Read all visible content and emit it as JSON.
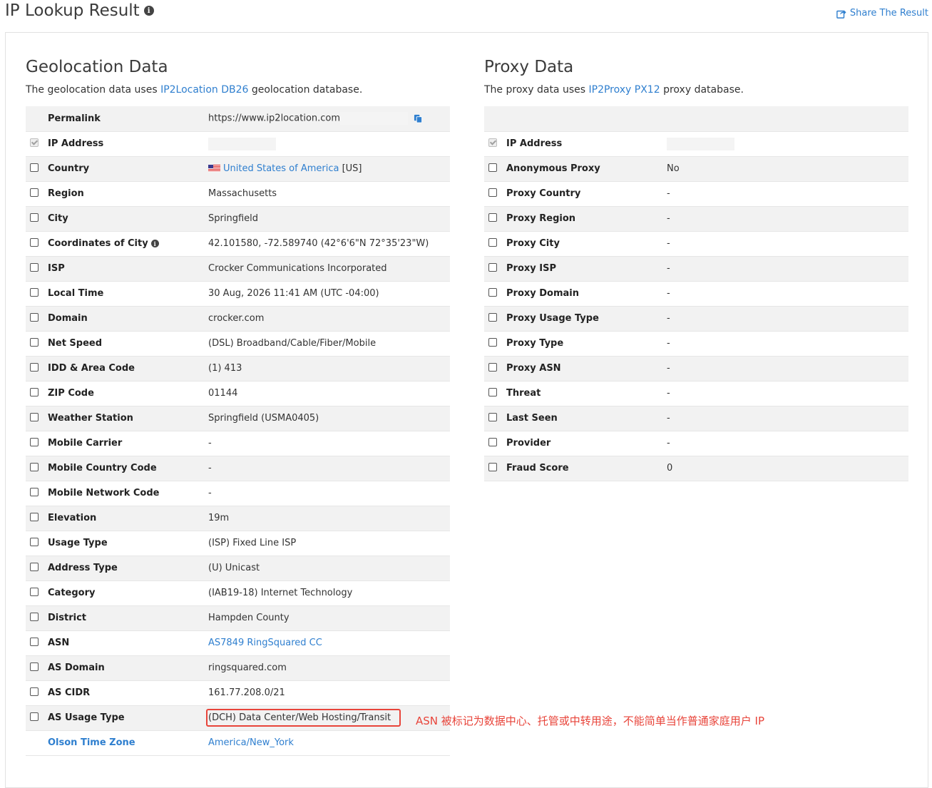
{
  "header": {
    "title": "IP Lookup Result",
    "share_label": "Share The Result"
  },
  "geo": {
    "title": "Geolocation Data",
    "desc_before": "The geolocation data uses ",
    "desc_link": "IP2Location DB26",
    "desc_after": " geolocation database.",
    "permalink_label": "Permalink",
    "permalink_value": "https://www.ip2location.com",
    "rows": [
      {
        "label": "IP Address",
        "value": ""
      },
      {
        "label": "Country",
        "value": "United States of America",
        "suffix": " [US]"
      },
      {
        "label": "Region",
        "value": "Massachusetts"
      },
      {
        "label": "City",
        "value": "Springfield"
      },
      {
        "label": "Coordinates of City",
        "value": "42.101580, -72.589740 (42°6'6\"N   72°35'23\"W)"
      },
      {
        "label": "ISP",
        "value": "Crocker Communications Incorporated"
      },
      {
        "label": "Local Time",
        "value": "30 Aug, 2026 11:41 AM (UTC -04:00)"
      },
      {
        "label": "Domain",
        "value": "crocker.com"
      },
      {
        "label": "Net Speed",
        "value": "(DSL) Broadband/Cable/Fiber/Mobile"
      },
      {
        "label": "IDD & Area Code",
        "value": "(1) 413"
      },
      {
        "label": "ZIP Code",
        "value": "01144"
      },
      {
        "label": "Weather Station",
        "value": "Springfield (USMA0405)"
      },
      {
        "label": "Mobile Carrier",
        "value": "-"
      },
      {
        "label": "Mobile Country Code",
        "value": "-"
      },
      {
        "label": "Mobile Network Code",
        "value": "-"
      },
      {
        "label": "Elevation",
        "value": "19m"
      },
      {
        "label": "Usage Type",
        "value": "(ISP) Fixed Line ISP"
      },
      {
        "label": "Address Type",
        "value": "(U) Unicast"
      },
      {
        "label": "Category",
        "value": "(IAB19-18) Internet Technology"
      },
      {
        "label": "District",
        "value": "Hampden County"
      },
      {
        "label": "ASN",
        "value": "AS7849 RingSquared CC"
      },
      {
        "label": "AS Domain",
        "value": "ringsquared.com"
      },
      {
        "label": "AS CIDR",
        "value": "161.77.208.0/21"
      },
      {
        "label": "AS Usage Type",
        "value": "(DCH) Data Center/Web Hosting/Transit"
      },
      {
        "label": "Olson Time Zone",
        "value": "America/New_York"
      }
    ]
  },
  "proxy": {
    "title": "Proxy Data",
    "desc_before": "The proxy data uses ",
    "desc_link": "IP2Proxy PX12",
    "desc_after": " proxy database.",
    "rows": [
      {
        "label": "IP Address",
        "value": ""
      },
      {
        "label": "Anonymous Proxy",
        "value": "No"
      },
      {
        "label": "Proxy Country",
        "value": "-"
      },
      {
        "label": "Proxy Region",
        "value": "-"
      },
      {
        "label": "Proxy City",
        "value": "-"
      },
      {
        "label": "Proxy ISP",
        "value": "-"
      },
      {
        "label": "Proxy Domain",
        "value": "-"
      },
      {
        "label": "Proxy Usage Type",
        "value": "-"
      },
      {
        "label": "Proxy Type",
        "value": "-"
      },
      {
        "label": "Proxy ASN",
        "value": "-"
      },
      {
        "label": "Threat",
        "value": "-"
      },
      {
        "label": "Last Seen",
        "value": "-"
      },
      {
        "label": "Provider",
        "value": "-"
      },
      {
        "label": "Fraud Score",
        "value": "0"
      }
    ]
  },
  "annotation": "ASN 被标记为数据中心、托管或中转用途，不能简单当作普通家庭用户 IP",
  "colors": {
    "link": "#2f7fcf",
    "highlight": "#e8443a"
  }
}
